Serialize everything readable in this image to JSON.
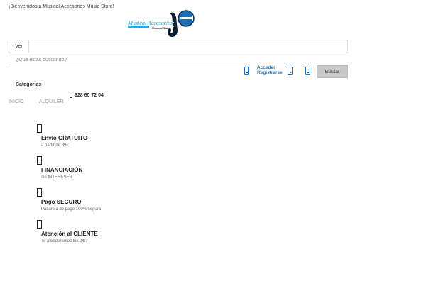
{
  "topbar": {
    "welcome": "¡Bienvenidos a Musical Accesorios Music Store!"
  },
  "logo": {
    "name": "Musical Accesorios",
    "tagline": "Musical Store"
  },
  "search": {
    "category_button": "Ver",
    "placeholder": "¿Qué estás buscando?",
    "submit": "Buscar"
  },
  "account": {
    "login": "Acceder",
    "register": "Registrarse"
  },
  "nav": {
    "categories": "Categorías",
    "phone": "928 60 72 04",
    "items": [
      "INICIO",
      "ALQUILER"
    ]
  },
  "features": [
    {
      "title": "Envío GRATUITO",
      "subtitle": "a partir de 89€"
    },
    {
      "title": "FINANCIACIÓN",
      "subtitle": "sin INTERESES"
    },
    {
      "title": "Pago SEGURO",
      "subtitle": "Pasarela de pago 100% segura"
    },
    {
      "title": "Atención al CLIENTE",
      "subtitle": "Te atenderemos los 24/7"
    }
  ],
  "colors": {
    "accent": "#1f6fb5",
    "logo_blue": "#2aa6d8",
    "button_bg": "#c8c8c8"
  }
}
